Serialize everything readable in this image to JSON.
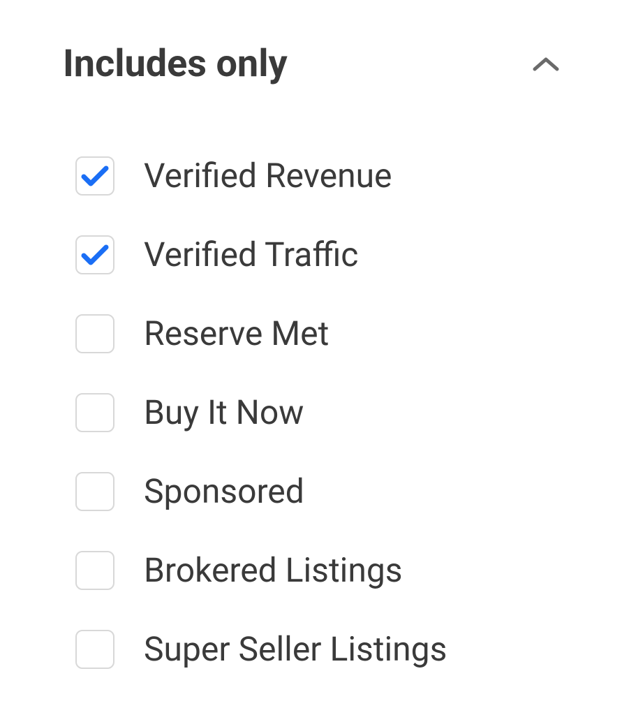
{
  "filter": {
    "title": "Includes only",
    "expanded": true,
    "options": [
      {
        "label": "Verified Revenue",
        "checked": true
      },
      {
        "label": "Verified Traffic",
        "checked": true
      },
      {
        "label": "Reserve Met",
        "checked": false
      },
      {
        "label": "Buy It Now",
        "checked": false
      },
      {
        "label": "Sponsored",
        "checked": false
      },
      {
        "label": "Brokered Listings",
        "checked": false
      },
      {
        "label": "Super Seller Listings",
        "checked": false
      }
    ]
  },
  "colors": {
    "check": "#1a6ef5",
    "text": "#3a3a3a",
    "border": "#d8d8d8",
    "chevron": "#6a6a6a"
  }
}
